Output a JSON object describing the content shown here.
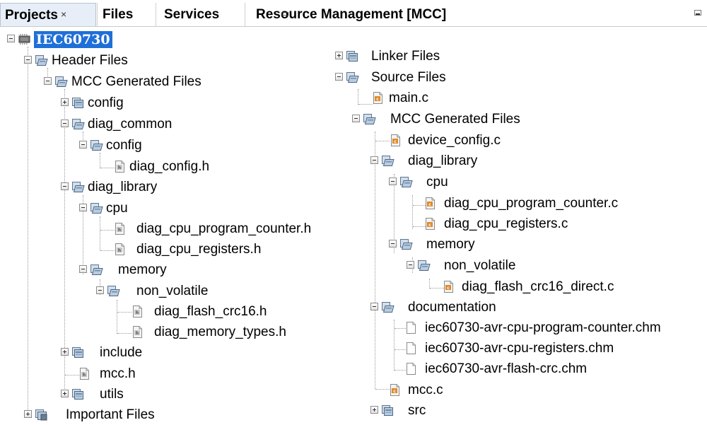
{
  "tabs": [
    {
      "label": "Projects",
      "close": "×"
    },
    {
      "label": "Files"
    },
    {
      "label": "Services"
    },
    {
      "label": "Resource Management [MCC]"
    }
  ],
  "tree": {
    "root": "IEC60730",
    "header_files": "Header Files",
    "mcc_generated_files": "MCC Generated Files",
    "config": "config",
    "diag_common": "diag_common",
    "diag_config_h": "diag_config.h",
    "diag_library": "diag_library",
    "cpu": "cpu",
    "diag_cpu_program_counter_h": "diag_cpu_program_counter.h",
    "diag_cpu_registers_h": "diag_cpu_registers.h",
    "memory": "memory",
    "non_volatile": "non_volatile",
    "diag_flash_crc16_h": "diag_flash_crc16.h",
    "diag_memory_types_h": "diag_memory_types.h",
    "include": "include",
    "mcc_h": "mcc.h",
    "utils": "utils",
    "important_files": "Important Files",
    "linker_files": "Linker Files",
    "source_files": "Source Files",
    "main_c": "main.c",
    "device_config_c": "device_config.c",
    "diag_cpu_program_counter_c": "diag_cpu_program_counter.c",
    "diag_cpu_registers_c": "diag_cpu_registers.c",
    "diag_flash_crc16_direct_c": "diag_flash_crc16_direct.c",
    "documentation": "documentation",
    "chm_program_counter": "iec60730-avr-cpu-program-counter.chm",
    "chm_registers": "iec60730-avr-cpu-registers.chm",
    "chm_flash_crc": "iec60730-avr-flash-crc.chm",
    "mcc_c": "mcc.c",
    "src": "src"
  }
}
